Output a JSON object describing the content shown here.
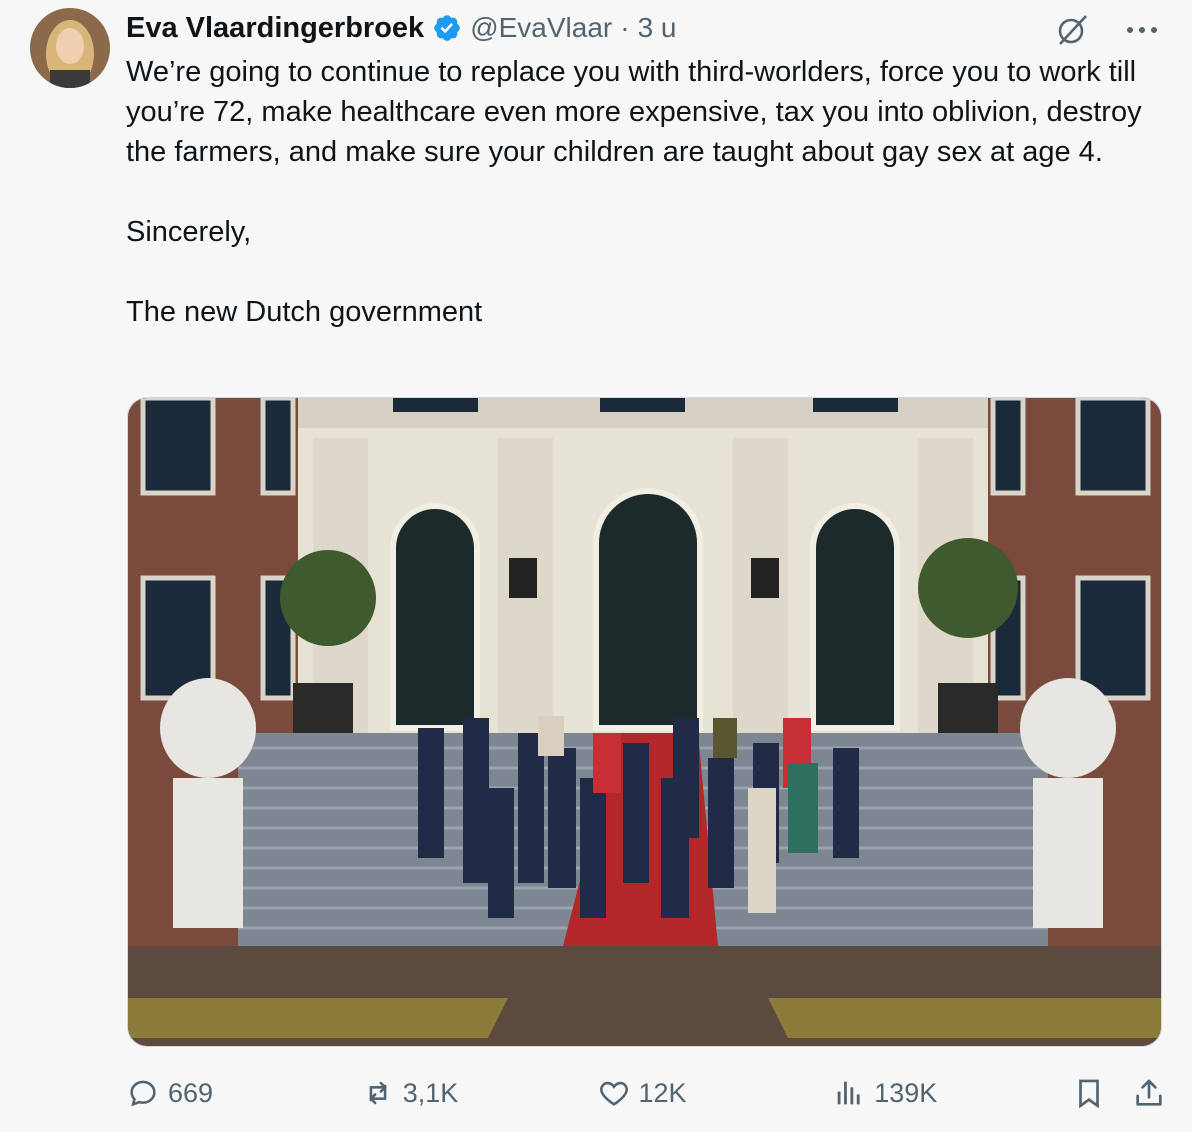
{
  "tweet": {
    "author_name": "Eva Vlaardingerbroek",
    "handle": "@EvaVlaar",
    "separator": "·",
    "time": "3 u",
    "lines": [
      "We’re going to continue to replace you  with third-worlders, force you to work till you’re 72, make healthcare even more expensive, tax you into oblivion, destroy the farmers, and make sure your children are taught about gay sex at age 4.",
      "Sincerely,",
      "The new Dutch government"
    ],
    "icons": {
      "verified": "verified-badge-icon",
      "grok": "grok-icon",
      "more": "more-icon"
    }
  },
  "actions": {
    "replies": "669",
    "reposts": "3,1K",
    "likes": "12K",
    "views": "139K"
  },
  "colors": {
    "verified": "#1d9bf0",
    "muted": "#536471",
    "text": "#0f1419",
    "background": "#f7f7f7"
  }
}
